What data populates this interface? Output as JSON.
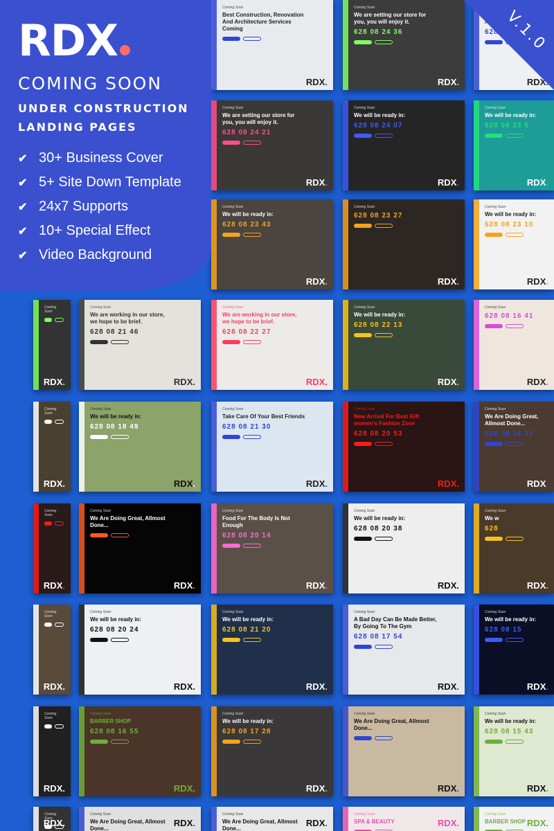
{
  "panel": {
    "brand": "RDX",
    "title": "COMING SOON",
    "subtitle1": "UNDER CONSTRUCTION",
    "subtitle2": "LANDING PAGES",
    "features": [
      "30+ Business Cover",
      "5+ Site Down Template",
      "24x7 Supports",
      "10+ Special Effect",
      "Video Background"
    ],
    "brand_dot_color": "#ff6a6a",
    "panel_color": "#3a50cf"
  },
  "version": "V.1.0",
  "card_label": "Coming Soon",
  "logo": "RDX",
  "rows": [
    [
      null,
      null,
      {
        "hl": "Best Construction, Renovation And Architecture Services Coming",
        "cd": "",
        "ac": "#2f45d6",
        "bg": "#e8ebee",
        "fg": "#222"
      },
      {
        "hl": "We are setting our store for you, you will enjoy it.",
        "cd": "628 08 24 36",
        "ac": "#7dff5e",
        "bg": "#3c3c3c",
        "fg": "#fff"
      },
      {
        "hl": "We Are Doing Great, Allmost Done...",
        "cd": "628",
        "ac": "#2f45d6",
        "bg": "#eef0f3",
        "fg": "#222"
      }
    ],
    [
      null,
      null,
      {
        "hl": "We are setting our store for you, you will enjoy it.",
        "cd": "628 08 24 21",
        "ac": "#ff4f8b",
        "bg": "#3b3838",
        "fg": "#fff"
      },
      {
        "hl": "We will be ready in:",
        "cd": "628 08 24 07",
        "ac": "#3d5bff",
        "bg": "#252525",
        "fg": "#fff"
      },
      {
        "hl": "We will be ready in:",
        "cd": "628 08 23 5",
        "ac": "#23e07a",
        "bg": "#1d9c98",
        "fg": "#fff"
      }
    ],
    [
      null,
      null,
      {
        "hl": "We will be ready in:",
        "cd": "628 08 23 43",
        "ac": "#f7a21b",
        "bg": "#4a4540",
        "fg": "#fff"
      },
      {
        "hl": "",
        "cd": "628 08 23 27",
        "ac": "#f7a21b",
        "bg": "#2d2723",
        "fg": "#fff"
      },
      {
        "hl": "We will be ready in:",
        "cd": "628 08 23 10",
        "ac": "#f7a21b",
        "bg": "#f2f2f2",
        "fg": "#222"
      }
    ],
    [
      {
        "hl": "",
        "cd": "",
        "ac": "#7dff5e",
        "bg": "#333",
        "fg": "#fff"
      },
      {
        "hl": "We are working in our store, we hope to be brief.",
        "cd": "628 08 21 46",
        "ac": "#333333",
        "bg": "#e4e2dc",
        "fg": "#333"
      },
      {
        "hl": "We are working in our store, we hope to be brief.",
        "cd": "628 08 22 27",
        "ac": "#ff3b5c",
        "bg": "#ecebea",
        "fg": "#ff3b5c"
      },
      {
        "hl": "We will be ready in:",
        "cd": "628 08 22 13",
        "ac": "#f7c21b",
        "bg": "#3a4a3a",
        "fg": "#fff"
      },
      {
        "hl": "",
        "cd": "628 08 16 41",
        "ac": "#d84cd8",
        "bg": "#efe7de",
        "fg": "#222"
      }
    ],
    [
      {
        "hl": "",
        "cd": "",
        "ac": "#fff",
        "bg": "#4a4030",
        "fg": "#fff"
      },
      {
        "hl": "We will be ready in:",
        "cd": "628 08 18 49",
        "ac": "#ffffff",
        "bg": "#8ca36a",
        "fg": "#111"
      },
      {
        "hl": "Take Care Of Your Best Friends",
        "cd": "628 08 21 30",
        "ac": "#2f45d6",
        "bg": "#dce6f0",
        "fg": "#222"
      },
      {
        "hl": "New Arrival For Best Gift women's Fashion Zone",
        "cd": "628 08 20 53",
        "ac": "#ff1a1a",
        "bg": "#2a1414",
        "fg": "#ff1a1a"
      },
      {
        "hl": "We Are Doing Great, Allmost Done...",
        "cd": "628 08 16 22",
        "ac": "#2f45d6",
        "bg": "#4a3a30",
        "fg": "#fff"
      }
    ],
    [
      {
        "hl": "",
        "cd": "",
        "ac": "#ff1a1a",
        "bg": "#2a1a1a",
        "fg": "#fff"
      },
      {
        "hl": "We Are Doing Great, Allmost Done...",
        "cd": "",
        "ac": "#ff5a1f",
        "bg": "#050505",
        "fg": "#fff"
      },
      {
        "hl": "Food For The Body Is Not Enough",
        "cd": "628 08 20 14",
        "ac": "#ff6ad0",
        "bg": "#5a5048",
        "fg": "#fff"
      },
      {
        "hl": "We will be ready in:",
        "cd": "628 08 20 38",
        "ac": "#111111",
        "bg": "#eeeeee",
        "fg": "#111"
      },
      {
        "hl": "We w",
        "cd": "628",
        "ac": "#f7c21b",
        "bg": "#4a3a2a",
        "fg": "#fff"
      }
    ],
    [
      {
        "hl": "",
        "cd": "",
        "ac": "#fff",
        "bg": "#5a4a3a",
        "fg": "#fff"
      },
      {
        "hl": "We will be ready in:",
        "cd": "628 08 20 24",
        "ac": "#111111",
        "bg": "#eef0f2",
        "fg": "#111"
      },
      {
        "hl": "We will be ready in:",
        "cd": "628 08 21 20",
        "ac": "#f7c21b",
        "bg": "#20304a",
        "fg": "#fff"
      },
      {
        "hl": "A Bad Day Can Be Made Better, By Going To The Gym",
        "cd": "628 08 17 54",
        "ac": "#2f45d6",
        "bg": "#e6e8ea",
        "fg": "#111"
      },
      {
        "hl": "We will be ready in:",
        "cd": "628 08 15",
        "ac": "#3d5bff",
        "bg": "#0a0f25",
        "fg": "#fff"
      }
    ],
    [
      {
        "hl": "",
        "cd": "",
        "ac": "#fff",
        "bg": "#202020",
        "fg": "#fff"
      },
      {
        "hl": "BARBER SHOP",
        "cd": "628 08 16 55",
        "ac": "#6fae3a",
        "bg": "#4a3528",
        "fg": "#6fae3a"
      },
      {
        "hl": "We will be ready in:",
        "cd": "628 08 17 28",
        "ac": "#f7a21b",
        "bg": "#3a3838",
        "fg": "#fff"
      },
      {
        "hl": "We Are Doing Great, Allmost Done...",
        "cd": "",
        "ac": "#2f45d6",
        "bg": "#c9b9a0",
        "fg": "#111"
      },
      {
        "hl": "We will be ready in:",
        "cd": "628 08 15 43",
        "ac": "#6fae3a",
        "bg": "#dfe8d0",
        "fg": "#111"
      }
    ],
    [
      {
        "hl": "",
        "cd": "",
        "ac": "#fff",
        "bg": "#333",
        "fg": "#fff"
      },
      {
        "hl": "We Are Doing Great, Allmost Done...",
        "cd": "",
        "ac": "#2f45d6",
        "bg": "#e0e0e0",
        "fg": "#111"
      },
      {
        "hl": "We Are Doing Great, Allmost Done...",
        "cd": "",
        "ac": "#2f45d6",
        "bg": "#e8e8e8",
        "fg": "#111"
      },
      {
        "hl": "SPA & BEAUTY",
        "cd": "",
        "ac": "#e84cae",
        "bg": "#f0e8e8",
        "fg": "#e84cae"
      },
      {
        "hl": "BARBER SHOP",
        "cd": "",
        "ac": "#6fae3a",
        "bg": "#f2f2f2",
        "fg": "#6fae3a"
      }
    ]
  ]
}
